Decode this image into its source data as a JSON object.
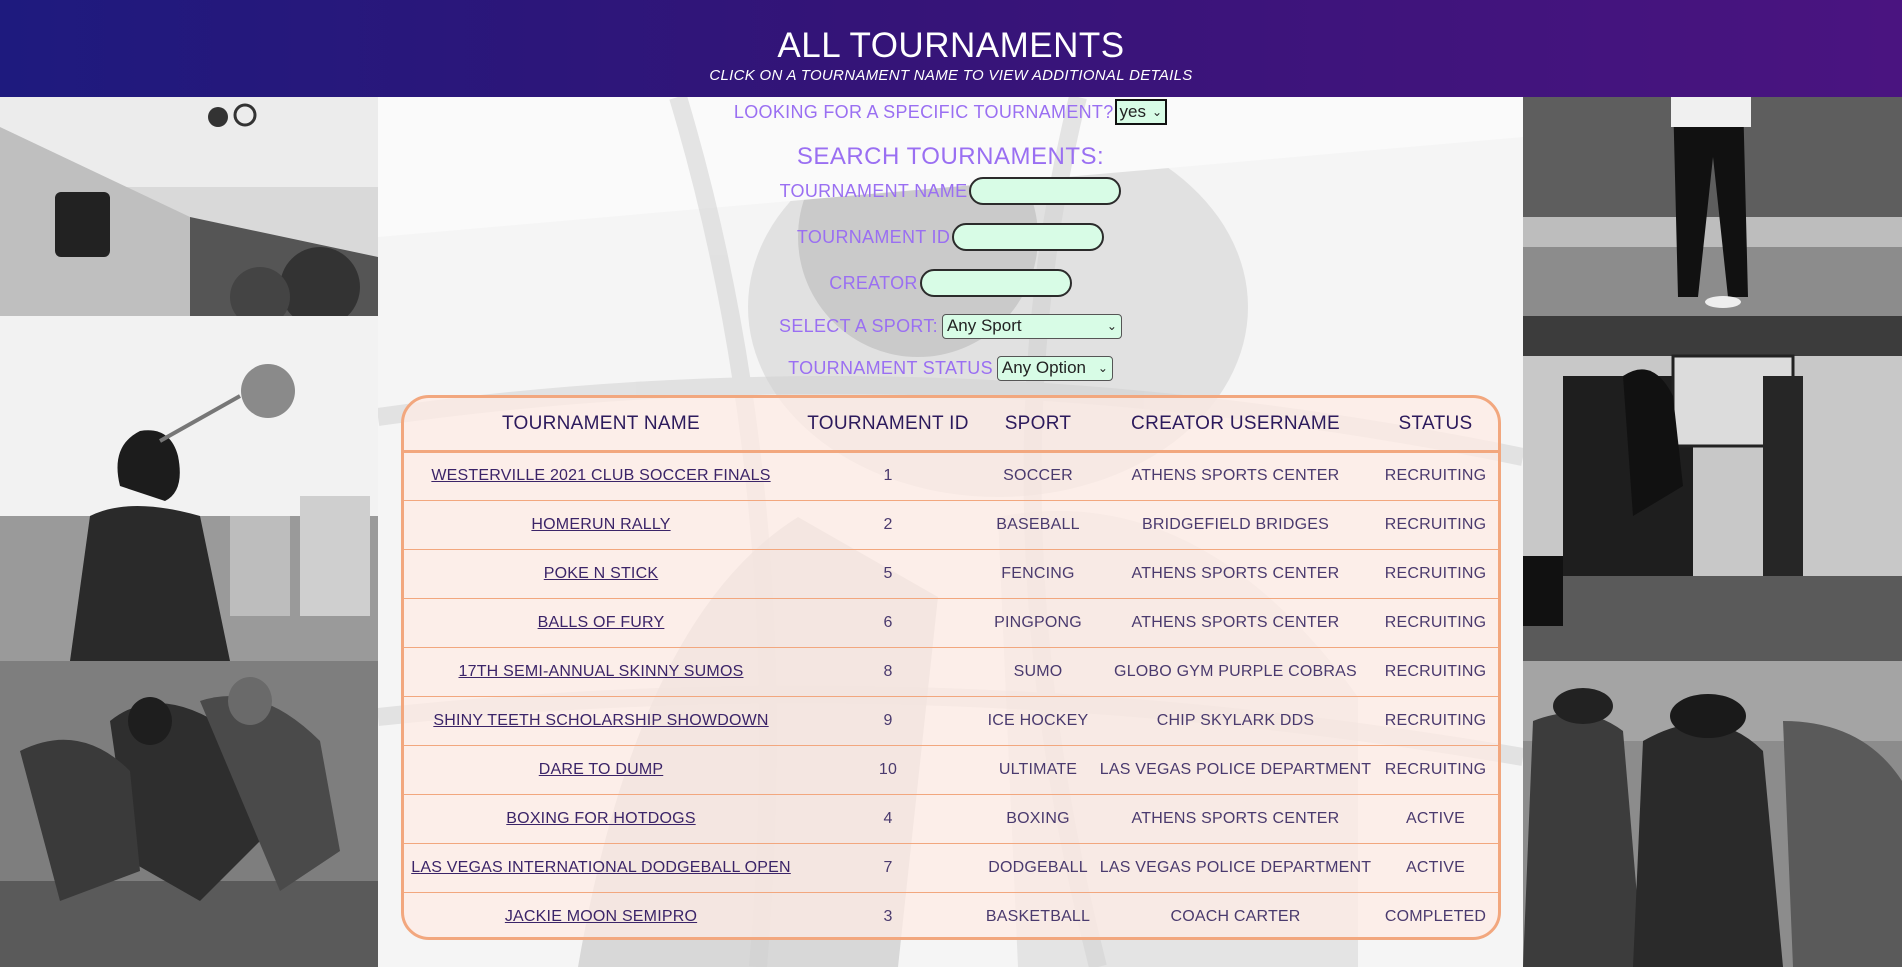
{
  "header": {
    "title": "ALL TOURNAMENTS",
    "subtitle": "CLICK ON A TOURNAMENT NAME TO VIEW ADDITIONAL DETAILS"
  },
  "search": {
    "specific_label": "LOOKING FOR A SPECIFIC TOURNAMENT?",
    "specific_value": "yes",
    "title": "SEARCH TOURNAMENTS:",
    "name_label": "TOURNAMENT NAME",
    "name_value": "",
    "id_label": "TOURNAMENT ID",
    "id_value": "",
    "creator_label": "CREATOR",
    "creator_value": "",
    "sport_label": "SELECT A SPORT:",
    "sport_value": "Any Sport",
    "status_label": "TOURNAMENT STATUS",
    "status_value": "Any Option"
  },
  "table": {
    "headers": [
      "TOURNAMENT NAME",
      "TOURNAMENT ID",
      "SPORT",
      "CREATOR USERNAME",
      "STATUS"
    ],
    "rows": [
      {
        "name": "WESTERVILLE 2021 CLUB SOCCER FINALS",
        "id": "1",
        "sport": "SOCCER",
        "creator": "ATHENS SPORTS CENTER",
        "status": "RECRUITING"
      },
      {
        "name": "HOMERUN RALLY",
        "id": "2",
        "sport": "BASEBALL",
        "creator": "BRIDGEFIELD BRIDGES",
        "status": "RECRUITING"
      },
      {
        "name": "POKE N STICK",
        "id": "5",
        "sport": "FENCING",
        "creator": "ATHENS SPORTS CENTER",
        "status": "RECRUITING"
      },
      {
        "name": "BALLS OF FURY",
        "id": "6",
        "sport": "PINGPONG",
        "creator": "ATHENS SPORTS CENTER",
        "status": "RECRUITING"
      },
      {
        "name": "17TH SEMI-ANNUAL SKINNY SUMOS",
        "id": "8",
        "sport": "SUMO",
        "creator": "GLOBO GYM PURPLE COBRAS",
        "status": "RECRUITING"
      },
      {
        "name": "SHINY TEETH SCHOLARSHIP SHOWDOWN",
        "id": "9",
        "sport": "ICE HOCKEY",
        "creator": "CHIP SKYLARK DDS",
        "status": "RECRUITING"
      },
      {
        "name": "DARE TO DUMP",
        "id": "10",
        "sport": "ULTIMATE",
        "creator": "LAS VEGAS POLICE DEPARTMENT",
        "status": "RECRUITING"
      },
      {
        "name": "BOXING FOR HOTDOGS",
        "id": "4",
        "sport": "BOXING",
        "creator": "ATHENS SPORTS CENTER",
        "status": "ACTIVE"
      },
      {
        "name": "LAS VEGAS INTERNATIONAL DODGEBALL OPEN",
        "id": "7",
        "sport": "DODGEBALL",
        "creator": "LAS VEGAS POLICE DEPARTMENT",
        "status": "ACTIVE"
      },
      {
        "name": "JACKIE MOON SEMIPRO",
        "id": "3",
        "sport": "BASKETBALL",
        "creator": "COACH CARTER",
        "status": "COMPLETED"
      }
    ]
  },
  "colors": {
    "header_gradient_start": "#1e1a7e",
    "header_gradient_end": "#4a1480",
    "label_purple": "#9a6ff2",
    "input_fill": "#d8fce6",
    "table_border": "#f2a77e",
    "table_fill": "#ffece4"
  },
  "images": [
    {
      "name": "bmx-stunt-photo"
    },
    {
      "name": "soccer-header-photo"
    },
    {
      "name": "sprint-start-photo"
    },
    {
      "name": "golfer-photo"
    },
    {
      "name": "basketball-dunk-photo"
    },
    {
      "name": "stadium-fans-photo"
    },
    {
      "name": "center-background-photo"
    }
  ]
}
